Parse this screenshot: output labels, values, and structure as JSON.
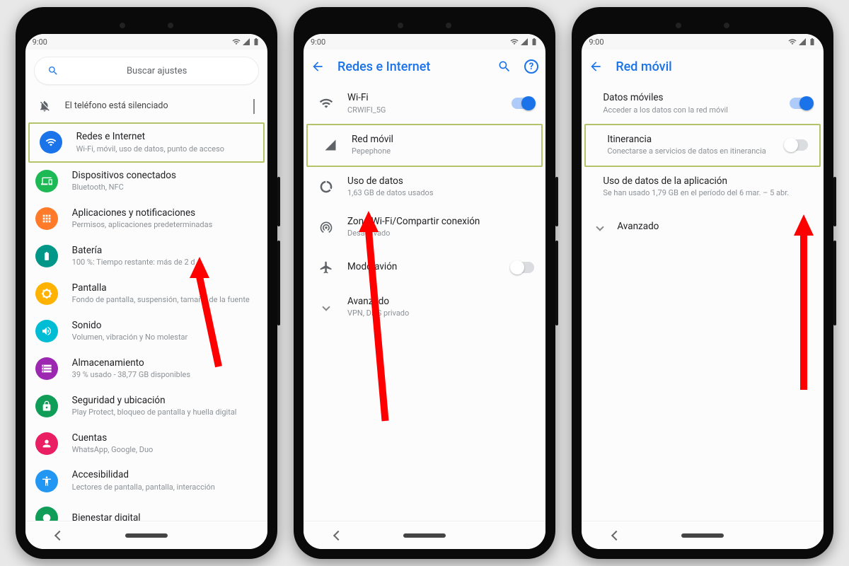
{
  "status": {
    "time": "9:00"
  },
  "phone1": {
    "search_placeholder": "Buscar ajustes",
    "banner": "El teléfono está silenciado",
    "items": [
      {
        "title": "Redes e Internet",
        "sub": "Wi-Fi, móvil, uso de datos, punto de acceso",
        "color": "#1a73e8"
      },
      {
        "title": "Dispositivos conectados",
        "sub": "Bluetooth, NFC",
        "color": "#1db954"
      },
      {
        "title": "Aplicaciones y notificaciones",
        "sub": "Permisos, aplicaciones predeterminadas",
        "color": "#ff7b29"
      },
      {
        "title": "Batería",
        "sub": "100 %: Tiempo restante: más de 2 d",
        "color": "#009688"
      },
      {
        "title": "Pantalla",
        "sub": "Fondo de pantalla, suspensión, tamaño de la fuente",
        "color": "#ffb300"
      },
      {
        "title": "Sonido",
        "sub": "Volumen, vibración y No molestar",
        "color": "#00bcd4"
      },
      {
        "title": "Almacenamiento",
        "sub": "39 % usado - 38,77 GB disponibles",
        "color": "#9c27b0"
      },
      {
        "title": "Seguridad y ubicación",
        "sub": "Play Protect, bloqueo de pantalla y huella digital",
        "color": "#0f9d58"
      },
      {
        "title": "Cuentas",
        "sub": "WhatsApp, Google, Duo",
        "color": "#e91e63"
      },
      {
        "title": "Accesibilidad",
        "sub": "Lectores de pantalla, pantalla, interacción",
        "color": "#2196f3"
      },
      {
        "title": "Bienestar digital",
        "sub": "",
        "color": "#0f9d58"
      }
    ]
  },
  "phone2": {
    "title": "Redes e Internet",
    "items": [
      {
        "title": "Wi-Fi",
        "sub": "CRWIFI_5G",
        "toggle": "on"
      },
      {
        "title": "Red móvil",
        "sub": "Pepephone"
      },
      {
        "title": "Uso de datos",
        "sub": "1,63 GB de datos usados"
      },
      {
        "title": "Zona Wi-Fi/Compartir conexión",
        "sub": "Desactivado"
      },
      {
        "title": "Modo avión",
        "sub": "",
        "toggle": "off"
      },
      {
        "title": "Avanzado",
        "sub": "VPN, DNS privado"
      }
    ]
  },
  "phone3": {
    "title": "Red móvil",
    "items": [
      {
        "title": "Datos móviles",
        "sub": "Acceder a los datos con la red móvil",
        "toggle": "on"
      },
      {
        "title": "Itinerancia",
        "sub": "Conectarse a servicios de datos en itinerancia",
        "toggle": "off"
      },
      {
        "title": "Uso de datos de la aplicación",
        "sub": "Se han usado 1,79 GB en el período del 6 mar. – 5 abr."
      },
      {
        "title": "Avanzado",
        "sub": ""
      }
    ]
  }
}
